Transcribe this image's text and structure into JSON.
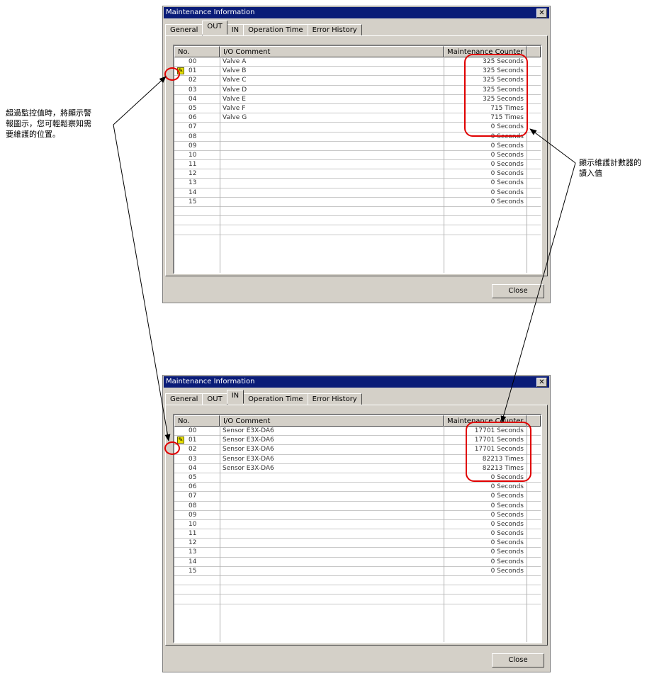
{
  "annotations": {
    "left": [
      "超過監控值時，將顯示警",
      "報圖示，您可輕鬆察知需",
      "要維護的位置。"
    ],
    "right": [
      "顯示維護計數器的",
      "讀入值"
    ]
  },
  "dialogs": [
    {
      "title": "Maintenance Information",
      "tabs": [
        "General",
        "OUT",
        "IN",
        "Operation Time",
        "Error History"
      ],
      "active_tab": "OUT",
      "columns": [
        "No.",
        "I/O Comment",
        "Maintenance Counter"
      ],
      "rows": [
        {
          "no": "00",
          "comment": "Valve A",
          "counter": "325 Seconds"
        },
        {
          "no": "01",
          "comment": "Valve B",
          "counter": "325 Seconds",
          "warn": true
        },
        {
          "no": "02",
          "comment": "Valve C",
          "counter": "325 Seconds"
        },
        {
          "no": "03",
          "comment": "Valve D",
          "counter": "325 Seconds"
        },
        {
          "no": "04",
          "comment": "Valve E",
          "counter": "325 Seconds"
        },
        {
          "no": "05",
          "comment": "Valve F",
          "counter": "715 Times"
        },
        {
          "no": "06",
          "comment": "Valve G",
          "counter": "715 Times"
        },
        {
          "no": "07",
          "comment": "",
          "counter": "0 Seconds"
        },
        {
          "no": "08",
          "comment": "",
          "counter": "0 Seconds"
        },
        {
          "no": "09",
          "comment": "",
          "counter": "0 Seconds"
        },
        {
          "no": "10",
          "comment": "",
          "counter": "0 Seconds"
        },
        {
          "no": "11",
          "comment": "",
          "counter": "0 Seconds"
        },
        {
          "no": "12",
          "comment": "",
          "counter": "0 Seconds"
        },
        {
          "no": "13",
          "comment": "",
          "counter": "0 Seconds"
        },
        {
          "no": "14",
          "comment": "",
          "counter": "0 Seconds"
        },
        {
          "no": "15",
          "comment": "",
          "counter": "0 Seconds"
        },
        {
          "no": "",
          "comment": "",
          "counter": ""
        },
        {
          "no": "",
          "comment": "",
          "counter": ""
        },
        {
          "no": "",
          "comment": "",
          "counter": ""
        }
      ],
      "close_label": "Close"
    },
    {
      "title": "Maintenance Information",
      "tabs": [
        "General",
        "OUT",
        "IN",
        "Operation Time",
        "Error History"
      ],
      "active_tab": "IN",
      "columns": [
        "No.",
        "I/O Comment",
        "Maintenance Counter"
      ],
      "rows": [
        {
          "no": "00",
          "comment": "Sensor E3X-DA6",
          "counter": "17701 Seconds"
        },
        {
          "no": "01",
          "comment": "Sensor E3X-DA6",
          "counter": "17701 Seconds",
          "warn": true
        },
        {
          "no": "02",
          "comment": "Sensor E3X-DA6",
          "counter": "17701 Seconds"
        },
        {
          "no": "03",
          "comment": "Sensor E3X-DA6",
          "counter": "82213 Times"
        },
        {
          "no": "04",
          "comment": "Sensor E3X-DA6",
          "counter": "82213 Times"
        },
        {
          "no": "05",
          "comment": "",
          "counter": "0 Seconds"
        },
        {
          "no": "06",
          "comment": "",
          "counter": "0 Seconds"
        },
        {
          "no": "07",
          "comment": "",
          "counter": "0 Seconds"
        },
        {
          "no": "08",
          "comment": "",
          "counter": "0 Seconds"
        },
        {
          "no": "09",
          "comment": "",
          "counter": "0 Seconds"
        },
        {
          "no": "10",
          "comment": "",
          "counter": "0 Seconds"
        },
        {
          "no": "11",
          "comment": "",
          "counter": "0 Seconds"
        },
        {
          "no": "12",
          "comment": "",
          "counter": "0 Seconds"
        },
        {
          "no": "13",
          "comment": "",
          "counter": "0 Seconds"
        },
        {
          "no": "14",
          "comment": "",
          "counter": "0 Seconds"
        },
        {
          "no": "15",
          "comment": "",
          "counter": "0 Seconds"
        },
        {
          "no": "",
          "comment": "",
          "counter": ""
        },
        {
          "no": "",
          "comment": "",
          "counter": ""
        },
        {
          "no": "",
          "comment": "",
          "counter": ""
        }
      ],
      "close_label": "Close"
    }
  ],
  "highlight_color": "#e00000"
}
